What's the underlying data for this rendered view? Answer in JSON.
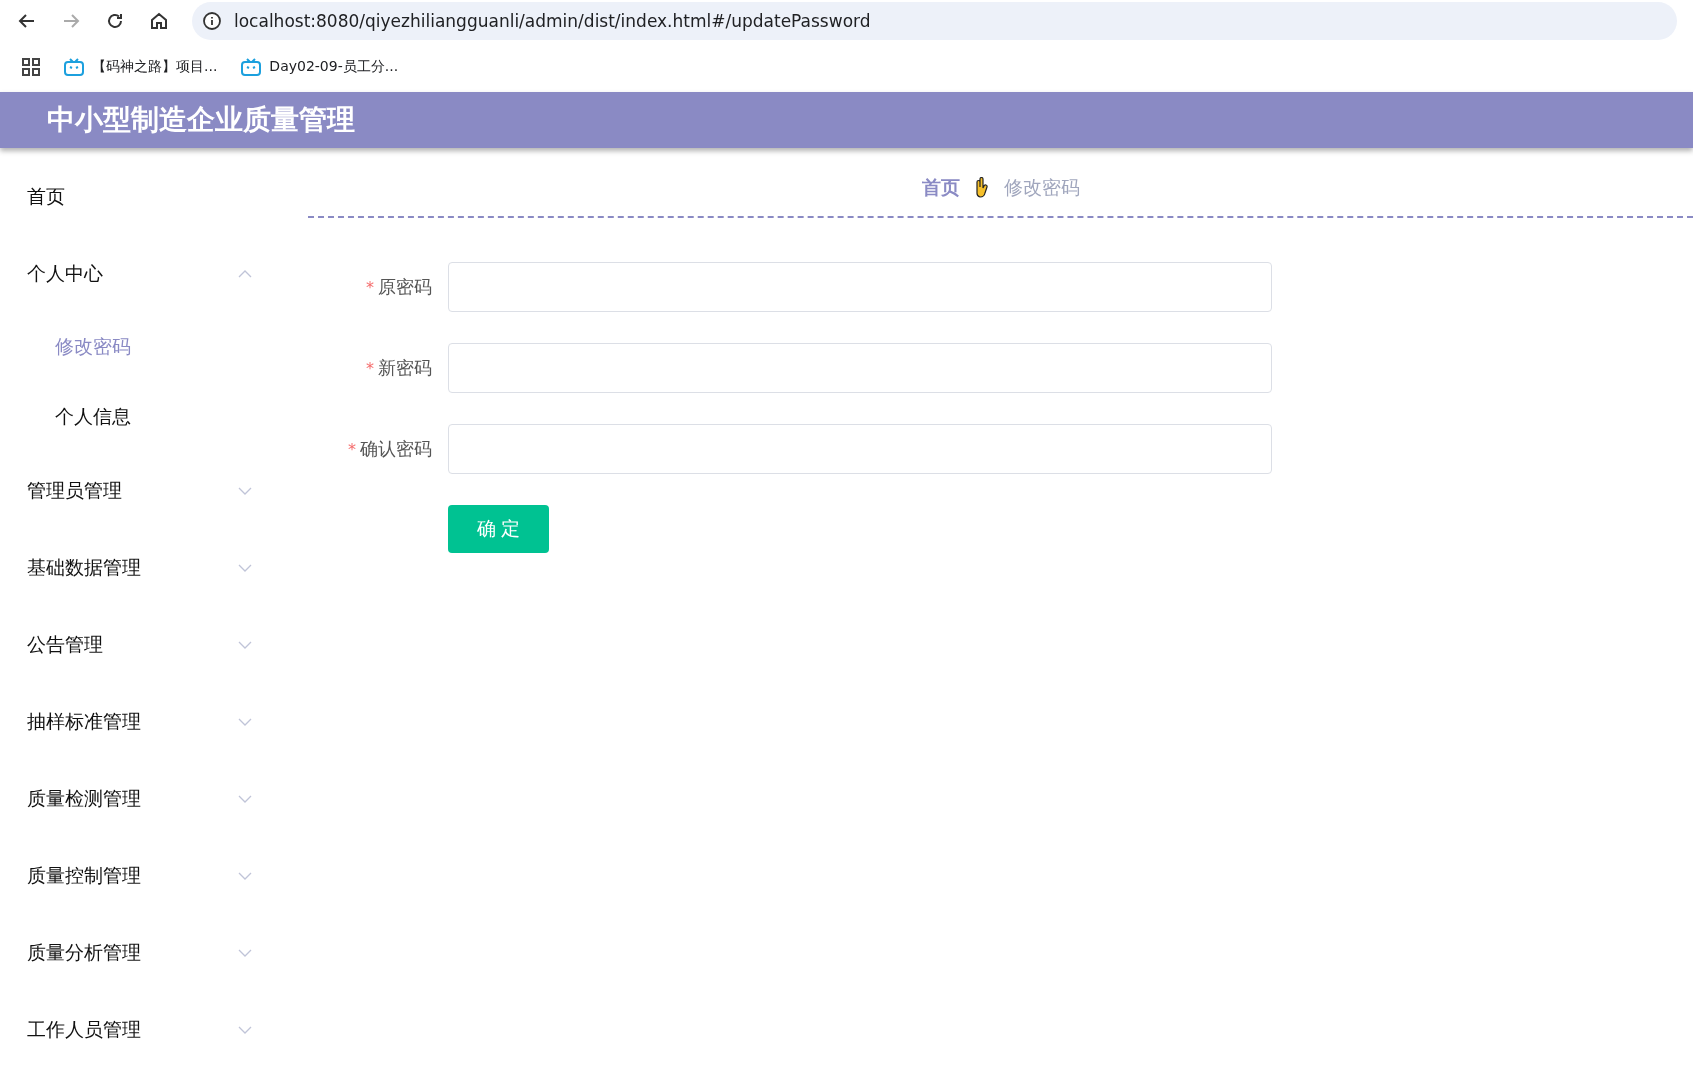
{
  "browser": {
    "url": "localhost:8080/qiyezhiliangguanli/admin/dist/index.html#/updatePassword",
    "bookmarks": [
      "【码神之路】项目...",
      "Day02-09-员工分..."
    ]
  },
  "header": {
    "title": "中小型制造企业质量管理"
  },
  "sidebar": {
    "items": [
      {
        "label": "首页",
        "selected": false
      },
      {
        "label": "个人中心",
        "expanded": true,
        "children": [
          {
            "label": "修改密码",
            "selected": true
          },
          {
            "label": "个人信息",
            "selected": false
          }
        ]
      },
      {
        "label": "管理员管理",
        "expanded": false
      },
      {
        "label": "基础数据管理",
        "expanded": false
      },
      {
        "label": "公告管理",
        "expanded": false
      },
      {
        "label": "抽样标准管理",
        "expanded": false
      },
      {
        "label": "质量检测管理",
        "expanded": false
      },
      {
        "label": "质量控制管理",
        "expanded": false
      },
      {
        "label": "质量分析管理",
        "expanded": false
      },
      {
        "label": "工作人员管理",
        "expanded": false
      }
    ]
  },
  "breadcrumb": [
    "首页",
    "修改密码"
  ],
  "form": {
    "fields": [
      {
        "label": "原密码",
        "required_mark": "*"
      },
      {
        "label": "新密码",
        "required_mark": "*"
      },
      {
        "label": "确认密码",
        "required_mark": "*"
      }
    ],
    "submit": "确 定"
  }
}
